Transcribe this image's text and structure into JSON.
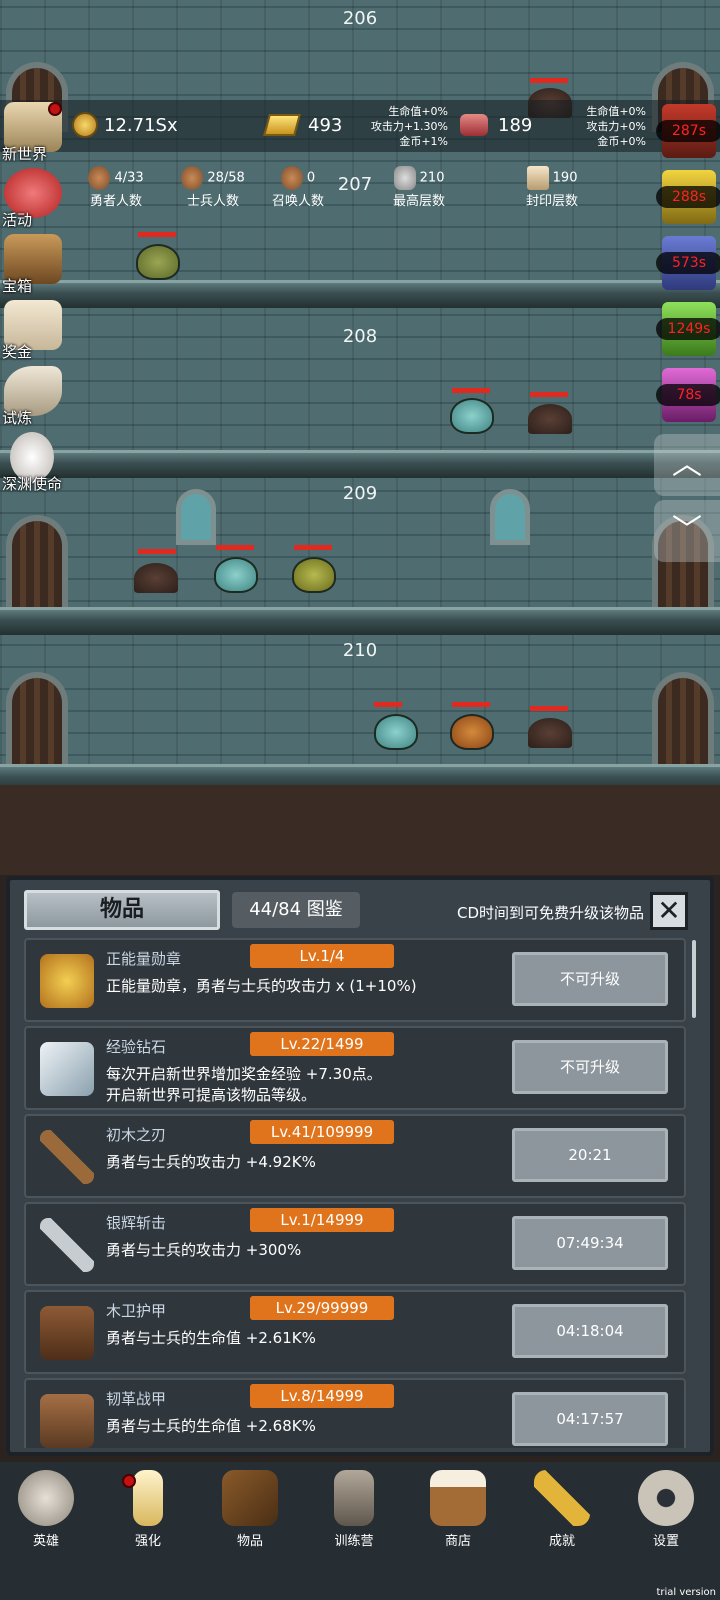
{
  "floors": [
    {
      "number": "206"
    },
    {
      "number": "207"
    },
    {
      "number": "208"
    },
    {
      "number": "209"
    },
    {
      "number": "210"
    }
  ],
  "hud": {
    "coins": "12.71Sx",
    "gold": "493",
    "gold_bonus": [
      "生命值+0%",
      "攻击力+1.30%",
      "金币+1%"
    ],
    "gems": "189",
    "gem_bonus": [
      "生命值+0%",
      "攻击力+0%",
      "金币+0%"
    ]
  },
  "stats": [
    {
      "value": "4/33",
      "label": "勇者人数"
    },
    {
      "value": "28/58",
      "label": "士兵人数"
    },
    {
      "value": "0",
      "label": "召唤人数"
    },
    {
      "value": "210",
      "label": "最高层数"
    },
    {
      "value": "190",
      "label": "封印层数"
    }
  ],
  "left_menu": [
    "新世界",
    "活动",
    "宝箱",
    "奖金",
    "试炼",
    "深渊使命"
  ],
  "right_timers": [
    "287s",
    "288s",
    "573s",
    "1249s",
    "78s"
  ],
  "panel": {
    "title": "物品",
    "count": "44/84 图鉴",
    "hint": "CD时间到可免费升级该物品",
    "close": "✕"
  },
  "items": [
    {
      "name": "正能量勋章",
      "level": "Lv.1/4",
      "desc": "正能量勋章，勇者与士兵的攻击力 x (1+10%)",
      "desc2": "",
      "button": "不可升级",
      "icon": "crown-icon"
    },
    {
      "name": "经验钻石",
      "level": "Lv.22/1499",
      "desc": "每次开启新世界增加奖金经验 +7.30点。",
      "desc2": "开启新世界可提高该物品等级。",
      "button": "不可升级",
      "icon": "diamond-icon"
    },
    {
      "name": "初木之刃",
      "level": "Lv.41/109999",
      "desc": "勇者与士兵的攻击力 +4.92K%",
      "desc2": "",
      "button": "20:21",
      "icon": "wooden-sword-icon"
    },
    {
      "name": "银辉斩击",
      "level": "Lv.1/14999",
      "desc": "勇者与士兵的攻击力 +300%",
      "desc2": "",
      "button": "07:49:34",
      "icon": "silver-sword-icon"
    },
    {
      "name": "木卫护甲",
      "level": "Lv.29/99999",
      "desc": "勇者与士兵的生命值 +2.61K%",
      "desc2": "",
      "button": "04:18:04",
      "icon": "wood-armor-icon"
    },
    {
      "name": "韧革战甲",
      "level": "Lv.8/14999",
      "desc": "勇者与士兵的生命值 +2.68K%",
      "desc2": "",
      "button": "04:17:57",
      "icon": "leather-armor-icon"
    }
  ],
  "nav": [
    "英雄",
    "强化",
    "物品",
    "训练营",
    "商店",
    "成就",
    "设置"
  ],
  "watermark": "trial version"
}
